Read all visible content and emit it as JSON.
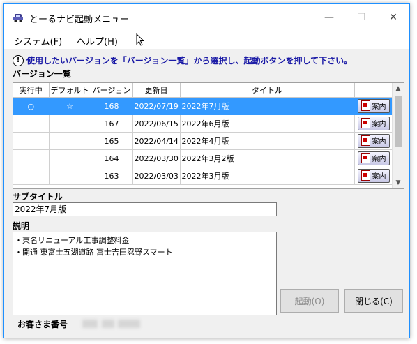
{
  "window": {
    "title": "とーるナビ起動メニュー",
    "controls": {
      "minimize": "—",
      "maximize": "☐",
      "close": "✕"
    }
  },
  "menu": [
    {
      "label": "システム(F)"
    },
    {
      "label": "ヘルプ(H)"
    }
  ],
  "info_message": "使用したいバージョンを「バージョン一覧」から選択し、起動ボタンを押して下さい。",
  "version_list": {
    "label": "バージョン一覧",
    "columns": [
      "実行中",
      "デフォルト",
      "バージョン",
      "更新日",
      "タイトル",
      ""
    ],
    "rows": [
      {
        "running": "○",
        "default": "☆",
        "version": "168",
        "date": "2022/07/19",
        "title": "2022年7月版",
        "button": "案内",
        "selected": true
      },
      {
        "running": "",
        "default": "",
        "version": "167",
        "date": "2022/06/15",
        "title": "2022年6月版",
        "button": "案内",
        "selected": false
      },
      {
        "running": "",
        "default": "",
        "version": "165",
        "date": "2022/04/14",
        "title": "2022年4月版",
        "button": "案内",
        "selected": false
      },
      {
        "running": "",
        "default": "",
        "version": "164",
        "date": "2022/03/30",
        "title": "2022年3月2版",
        "button": "案内",
        "selected": false
      },
      {
        "running": "",
        "default": "",
        "version": "163",
        "date": "2022/03/03",
        "title": "2022年3月版",
        "button": "案内",
        "selected": false
      }
    ]
  },
  "subtitle": {
    "label": "サブタイトル",
    "value": "2022年7月版"
  },
  "description": {
    "label": "説明",
    "lines": [
      "・東名リニューアル工事調整料金",
      "・開通 東富士五湖道路 富士吉田忍野スマート"
    ]
  },
  "buttons": {
    "launch": "起動(O)",
    "close": "閉じる(C)"
  },
  "customer": {
    "label": "お客さま番号"
  }
}
